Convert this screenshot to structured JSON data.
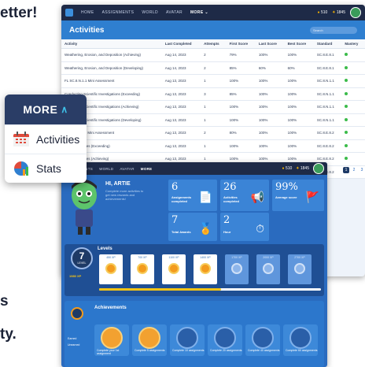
{
  "fragments": {
    "top_heading": "etter!",
    "left_s": "s",
    "left_ty": "ty."
  },
  "top": {
    "nav": [
      "HOME",
      "ASSIGNMENTS",
      "WORLD",
      "AVATAR",
      "MORE"
    ],
    "nav_more_symbol": "⌄",
    "coins": "510",
    "points": "1845",
    "section_title": "Activities",
    "search_placeholder": "Search",
    "columns": [
      "Activity",
      "Last Completed",
      "Attempts",
      "First Score",
      "Last Score",
      "Best Score",
      "Standard",
      "Mastery"
    ],
    "rows": [
      [
        "Weathering, Erosion, and Deposition (Achieving)",
        "Aug 14, 2023",
        "2",
        "79%",
        "100%",
        "100%",
        "SC.8.E.8.1"
      ],
      [
        "Weathering, Erosion, and Deposition (Developing)",
        "Aug 14, 2023",
        "2",
        "85%",
        "60%",
        "60%",
        "SC.8.E.8.1"
      ],
      [
        "FL SC.8.N.1.1 Mini Assessment",
        "Aug 13, 2023",
        "1",
        "100%",
        "100%",
        "100%",
        "SC.8.N.1.1"
      ],
      [
        "Conducting Scientific Investigations (Exceeding)",
        "Aug 13, 2023",
        "3",
        "85%",
        "100%",
        "100%",
        "SC.8.N.1.1"
      ],
      [
        "Conducting Scientific Investigations (Achieving)",
        "Aug 13, 2023",
        "1",
        "100%",
        "100%",
        "100%",
        "SC.8.N.1.1"
      ],
      [
        "Conducting Scientific Investigations (Developing)",
        "Aug 13, 2023",
        "1",
        "100%",
        "100%",
        "100%",
        "SC.8.N.1.1"
      ],
      [
        "FL SC.8.E.8.2 Mini Assessment",
        "Aug 13, 2023",
        "2",
        "80%",
        "100%",
        "100%",
        "SC.8.E.8.2"
      ],
      [
        "Earth Structures (Exceeding)",
        "Aug 13, 2023",
        "1",
        "100%",
        "100%",
        "100%",
        "SC.8.E.8.2"
      ],
      [
        "Earth Structures (Achieving)",
        "Aug 13, 2023",
        "1",
        "100%",
        "100%",
        "100%",
        "SC.8.E.8.2"
      ],
      [
        "Earth Structures (Developing)",
        "Aug 13, 2023",
        "2",
        "94%",
        "100%",
        "100%",
        "SC.8.E.8.2"
      ]
    ]
  },
  "menu": {
    "title": "MORE",
    "chevron": "∧",
    "items": [
      {
        "label": "Activities",
        "icon": "calendar-icon"
      },
      {
        "label": "Stats",
        "icon": "pie-chart-icon"
      }
    ]
  },
  "bottom": {
    "nav": [
      "ASSIGNMENTS",
      "WORLD",
      "AVATAR",
      "MORE"
    ],
    "coins": "510",
    "points": "1845",
    "greeting": "HI, ARTIE",
    "greeting_sub": "Complete more activities to get new rewards and achievements!",
    "stats": [
      {
        "value": "6",
        "label": "Assignments completed"
      },
      {
        "value": "26",
        "label": "Activities completed"
      },
      {
        "value": "99%",
        "label": "Average score"
      },
      {
        "value": "7",
        "label": "Total Awards"
      },
      {
        "value": "2",
        "label": "Hour"
      }
    ],
    "levels_title": "Levels",
    "level": {
      "number": "7",
      "word": "LEVEL",
      "xp": "1980 XP"
    },
    "xp_cards": [
      "450 XP",
      "700 XP",
      "1100 XP",
      "1400 XP",
      "1700 XP",
      "2000 XP",
      "2700 XP"
    ],
    "level_progress": 0.55,
    "achievements_title": "Achievements",
    "legend": [
      "Earned",
      "Unearned"
    ],
    "achievement_cards": [
      "Complete your 1st assignment",
      "Complete 5 assignments",
      "Complete 10 assignments",
      "Complete 20 assignments",
      "Complete 40 assignments",
      "Complete 60 assignments"
    ],
    "pager": [
      "1",
      "2",
      "3"
    ]
  },
  "colors": {
    "nav_bg": "#1e2a47",
    "primary_blue": "#2f7fd0",
    "accent_orange": "#f39b1d",
    "mastery_green": "#3bbb4a"
  }
}
